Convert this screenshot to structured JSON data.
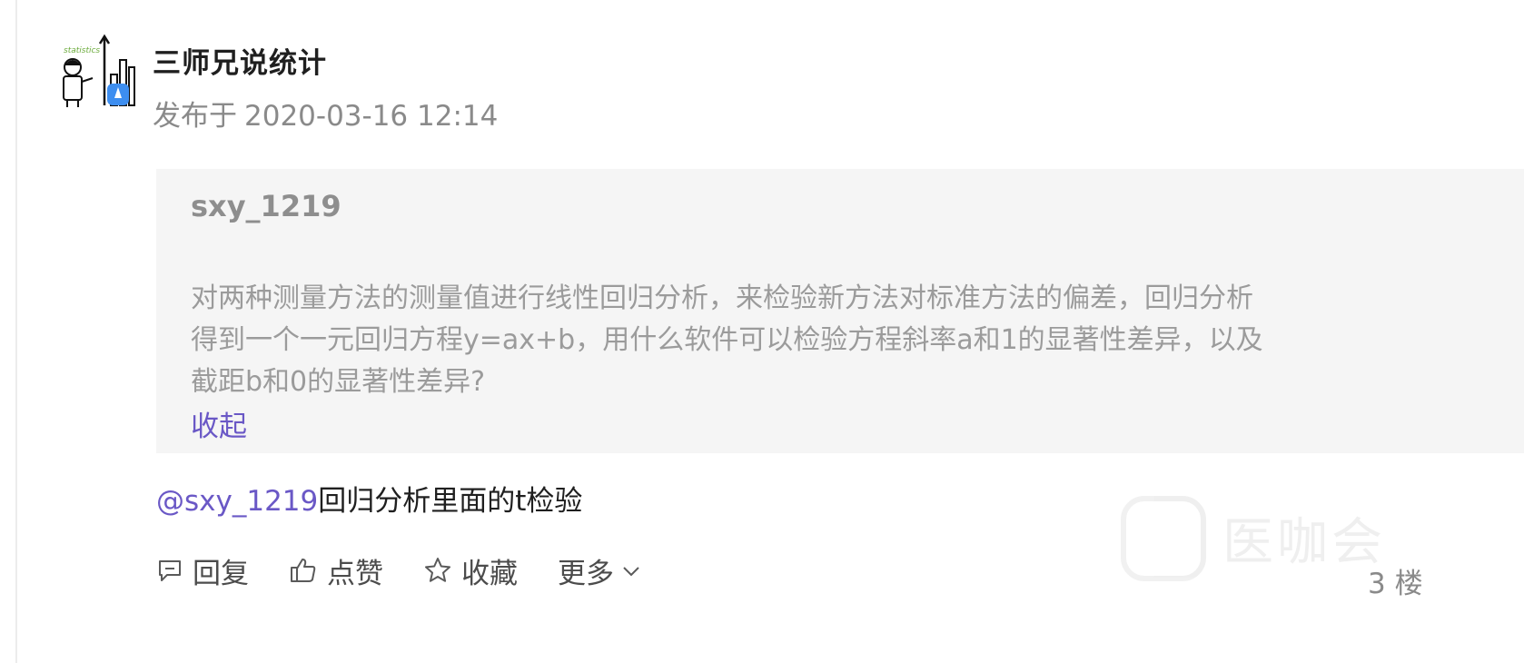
{
  "author": {
    "name": "三师兄说统计",
    "time_prefix": "发布于",
    "time": "2020-03-16 12:14",
    "avatar_caption": "statistics"
  },
  "quote": {
    "user": "sxy_1219",
    "lines": [
      "对两种测量方法的测量值进行线性回归分析，来检验新方法对标准方法的偏差，回归分析",
      "得到一个一元回归方程y=ax+b，用什么软件可以检验方程斜率a和1的显著性差异，以及",
      "截距b和0的显著性差异?"
    ],
    "collapse_label": "收起"
  },
  "reply": {
    "mention": "@sxy_1219",
    "text": "回归分析里面的t检验"
  },
  "actions": {
    "reply_label": "回复",
    "like_label": "点赞",
    "favorite_label": "收藏",
    "more_label": "更多"
  },
  "floor": "3 楼",
  "watermark": {
    "text": "医咖会"
  },
  "colors": {
    "accent": "#6a58c6",
    "quote_bg": "#f5f5f5",
    "muted": "#8a8a8a"
  }
}
